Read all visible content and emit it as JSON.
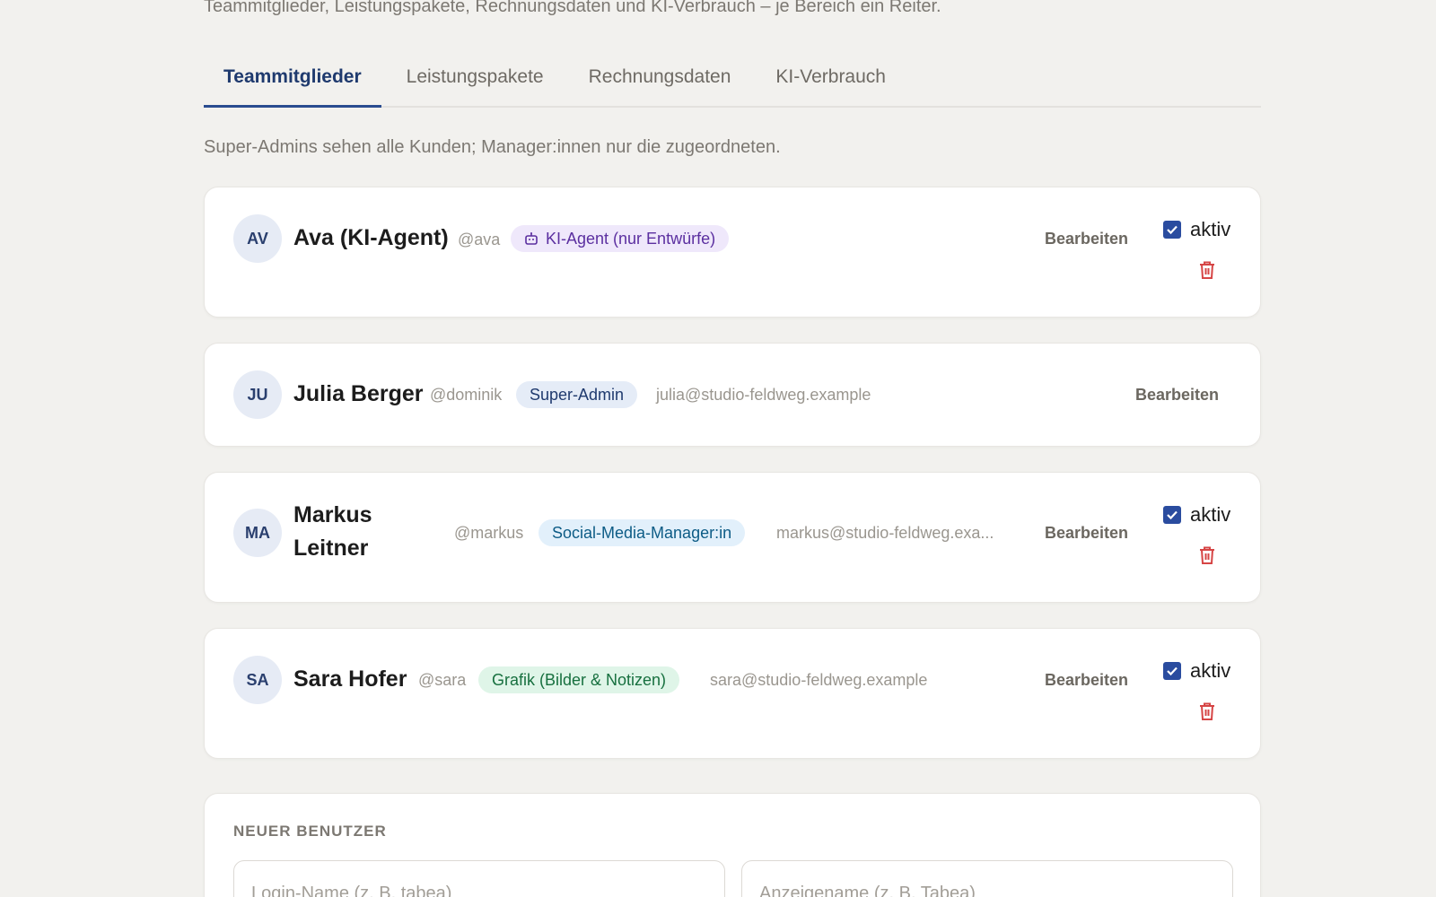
{
  "intro_text": "Teammitglieder, Leistungspakete, Rechnungsdaten und KI-Verbrauch – je Bereich ein Reiter.",
  "tabs": [
    {
      "label": "Teammitglieder",
      "active": true
    },
    {
      "label": "Leistungspakete",
      "active": false
    },
    {
      "label": "Rechnungsdaten",
      "active": false
    },
    {
      "label": "KI-Verbrauch",
      "active": false
    }
  ],
  "hint_text": "Super-Admins sehen alle Kunden; Manager:innen nur die zugeordneten.",
  "members": [
    {
      "initials": "AV",
      "name": "Ava (KI-Agent)",
      "handle": "@ava",
      "role": "KI-Agent (nur Entwürfe)",
      "role_icon": "robot-icon",
      "email": "",
      "edit_label": "Bearbeiten",
      "active_label": "aktiv",
      "active": true
    },
    {
      "initials": "JU",
      "name": "Julia Berger",
      "handle": "@dominik",
      "role": "Super-Admin",
      "email": "julia@studio-feldweg.example",
      "edit_label": "Bearbeiten"
    },
    {
      "initials": "MA",
      "name": "Markus Leitner",
      "handle": "@markus",
      "role": "Social-Media-Manager:in",
      "email": "markus@studio-feldweg.exa...",
      "edit_label": "Bearbeiten",
      "active_label": "aktiv",
      "active": true
    },
    {
      "initials": "SA",
      "name": "Sara Hofer",
      "handle": "@sara",
      "role": "Grafik (Bilder & Notizen)",
      "email": "sara@studio-feldweg.example",
      "edit_label": "Bearbeiten",
      "active_label": "aktiv",
      "active": true
    }
  ],
  "new_user": {
    "section_label": "NEUER BENUTZER",
    "login_placeholder": "Login-Name (z. B. tabea)",
    "display_placeholder": "Anzeigename (z. B. Tabea)"
  },
  "colors": {
    "accent": "#2a4c9f",
    "delete": "#d64545",
    "background": "#f2f1ee"
  }
}
